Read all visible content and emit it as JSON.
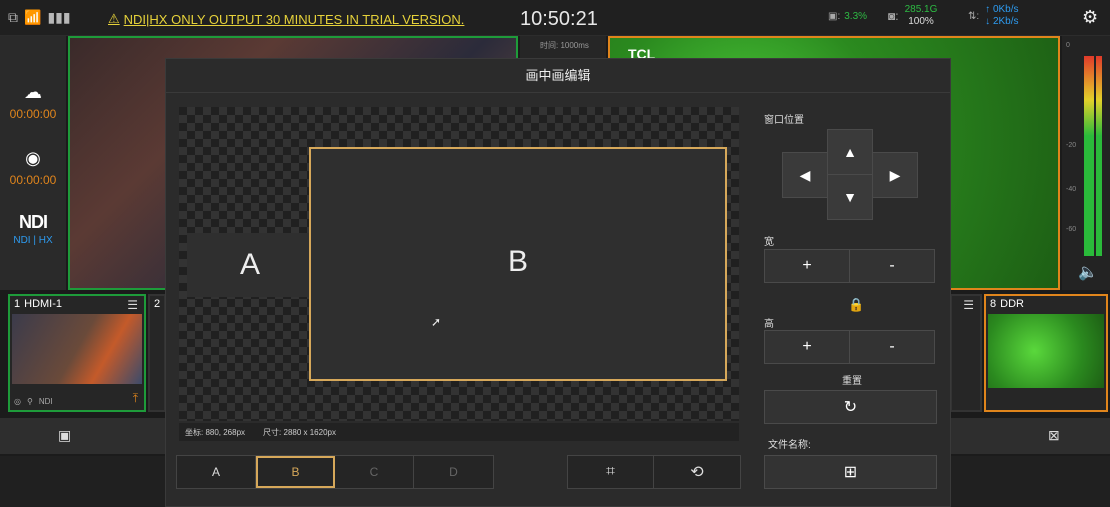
{
  "status": {
    "trial_notice": "NDI|HX ONLY OUTPUT 30 MINUTES IN TRIAL VERSION.",
    "clock": "10:50:21",
    "cpu": "3.3%",
    "disk_size": "285.1G",
    "disk_pct": "100%",
    "net_up": "0Kb/s",
    "net_down": "2Kb/s"
  },
  "sidebar": {
    "stream_time": "00:00:00",
    "record_time": "00:00:00",
    "ndi_logo": "NDI",
    "ndi_label": "NDI | HX"
  },
  "monitor": {
    "center_label": "时间: 1000ms",
    "program_logo": "TCL"
  },
  "meter": {
    "scale": [
      "0",
      "-20",
      "-40",
      "-60"
    ]
  },
  "sources": [
    {
      "num": "1",
      "name": "HDMI-1",
      "tag": "NDI"
    },
    {
      "num": "2",
      "name": ""
    },
    {
      "num": "8",
      "name": "DDR"
    }
  ],
  "modal": {
    "title": "画中画编辑",
    "window_a": "A",
    "window_b": "B",
    "coord_label": "坐标: 880, 268px",
    "size_label": "尺寸: 2880 x 1620px",
    "tabs": [
      "A",
      "B",
      "C",
      "D"
    ],
    "selected_tab": "B",
    "position_label": "窗口位置",
    "width_label": "宽",
    "height_label": "高",
    "plus": "+",
    "minus": "-",
    "reset_label": "重置",
    "filename_label": "文件名称:"
  },
  "icons": {
    "crop": "crop-icon",
    "image_swap": "image-swap-icon",
    "image_add": "image-add-icon",
    "lock": "lock-icon",
    "refresh": "refresh-icon"
  },
  "colors": {
    "accent_gold": "#d6a85a",
    "preview_green": "#1e9b3a",
    "program_orange": "#e0851c",
    "net_blue": "#2d9bf0",
    "trial_yellow": "#e6d23a"
  }
}
